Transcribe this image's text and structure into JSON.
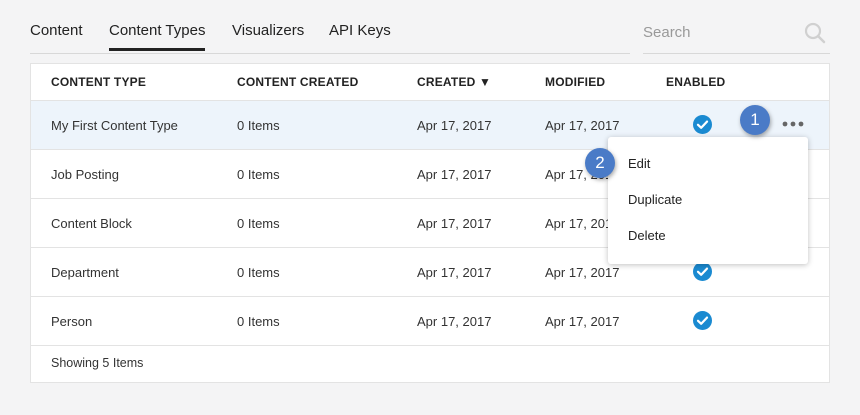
{
  "tabs": [
    {
      "label": "Content",
      "active": false
    },
    {
      "label": "Content Types",
      "active": true
    },
    {
      "label": "Visualizers",
      "active": false
    },
    {
      "label": "API Keys",
      "active": false
    }
  ],
  "search": {
    "placeholder": "Search",
    "icon": "search-icon"
  },
  "table": {
    "columns": [
      "CONTENT TYPE",
      "CONTENT CREATED",
      "CREATED ▼",
      "MODIFIED",
      "ENABLED"
    ],
    "rows": [
      {
        "name": "My First Content Type",
        "count": "0 Items",
        "created": "Apr 17, 2017",
        "modified": "Apr 17, 2017",
        "enabled": true
      },
      {
        "name": "Job Posting",
        "count": "0 Items",
        "created": "Apr 17, 2017",
        "modified": "Apr 17, 2017",
        "enabled": true
      },
      {
        "name": "Content Block",
        "count": "0 Items",
        "created": "Apr 17, 2017",
        "modified": "Apr 17, 2017",
        "enabled": true
      },
      {
        "name": "Department",
        "count": "0 Items",
        "created": "Apr 17, 2017",
        "modified": "Apr 17, 2017",
        "enabled": true
      },
      {
        "name": "Person",
        "count": "0 Items",
        "created": "Apr 17, 2017",
        "modified": "Apr 17, 2017",
        "enabled": true
      }
    ],
    "footer": "Showing 5 Items"
  },
  "menu": {
    "items": [
      "Edit",
      "Duplicate",
      "Delete"
    ]
  },
  "callouts": [
    "1",
    "2"
  ],
  "colors": {
    "accent": "#1a8ad1",
    "callout": "#4a7bc7",
    "highlight_row": "#edf4fb"
  }
}
